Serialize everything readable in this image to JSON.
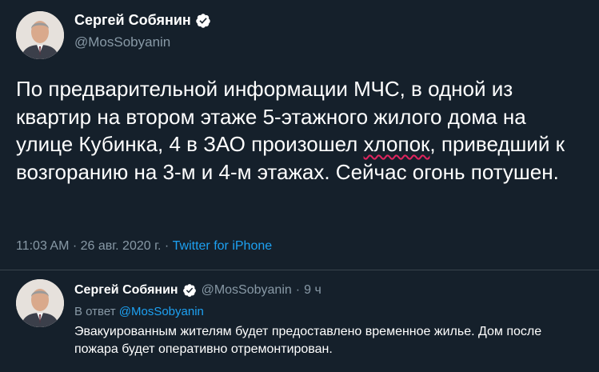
{
  "colors": {
    "background": "#15202b",
    "text": "#ffffff",
    "secondary": "#8899a6",
    "link": "#1da1f2",
    "spellcheck": "#e0245e",
    "divider": "#38444d"
  },
  "tweet": {
    "author_name": "Сергей Собянин",
    "handle": "@MosSobyanin",
    "verified_icon": "verified-badge-icon",
    "text_before": "По предварительной информации МЧС, в одной из квартир на втором этаже 5-этажного жилого дома на улице Кубинка, 4 в ЗАО произошел ",
    "text_highlight": "хлопок",
    "text_after": ", приведший к возгоранию на 3-м и 4-м этажах. Сейчас огонь потушен.",
    "time": "11:03 AM",
    "separator": " · ",
    "date": "26 авг. 2020 г.",
    "source": "Twitter for iPhone"
  },
  "reply": {
    "author_name": "Сергей Собянин",
    "handle": "@MosSobyanin",
    "separator": "·",
    "time": "9 ч",
    "reply_prefix": "В ответ ",
    "reply_mention": "@MosSobyanin",
    "text": "Эвакуированным жителям будет предоставлено временное жилье. Дом после пожара будет оперативно отремонтирован."
  }
}
